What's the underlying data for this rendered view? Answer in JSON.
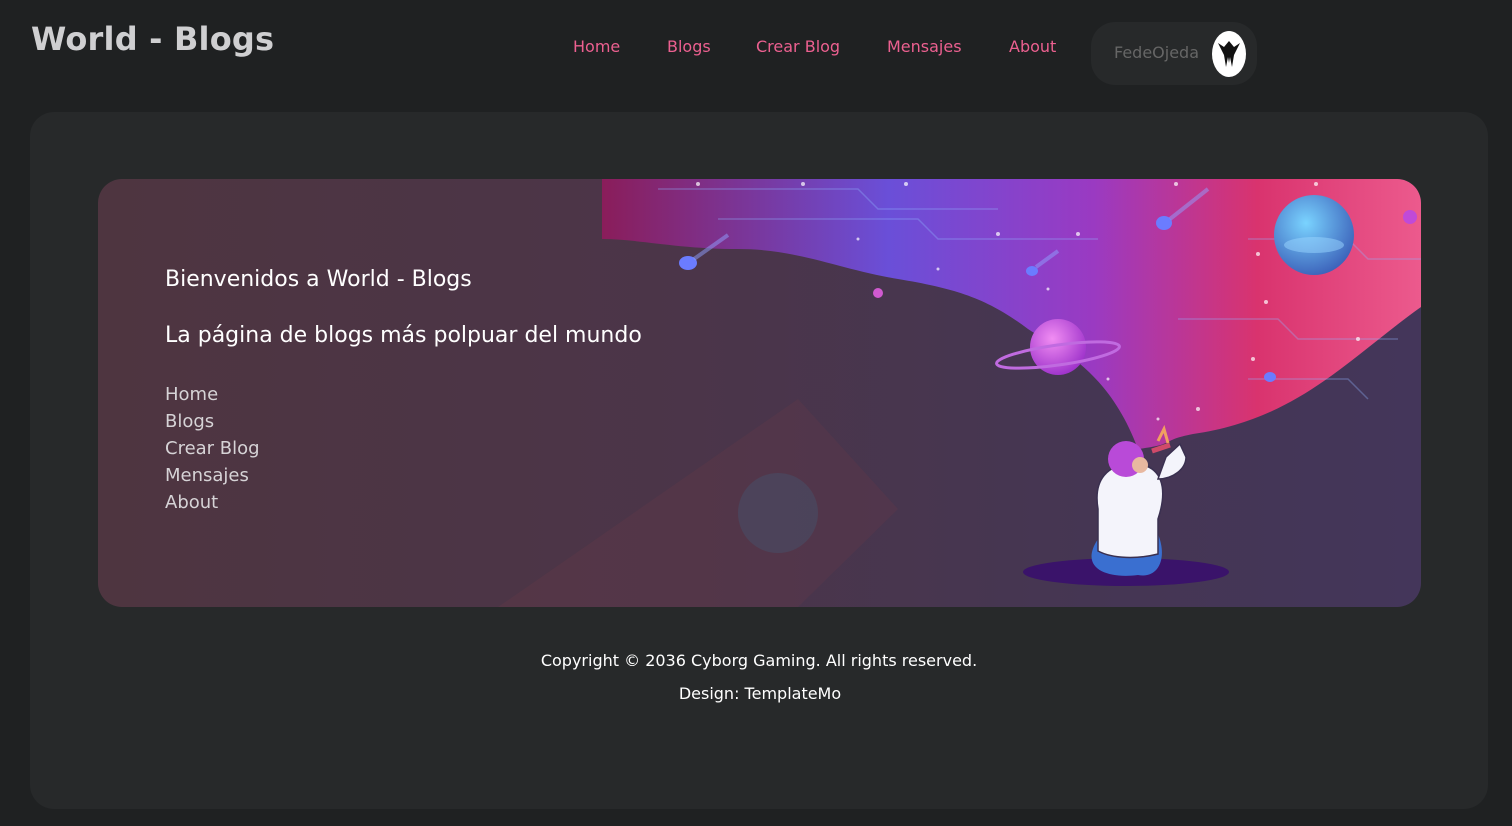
{
  "header": {
    "logo": "World - Blogs",
    "nav": [
      {
        "label": "Home"
      },
      {
        "label": "Blogs"
      },
      {
        "label": "Crear Blog"
      },
      {
        "label": "Mensajes"
      },
      {
        "label": "About"
      }
    ],
    "profile": {
      "username": "FedeOjeda",
      "avatar_icon": "user-avatar-icon"
    }
  },
  "banner": {
    "title": "Bienvenidos a World - Blogs",
    "subtitle": "La página de blogs más polpuar del mundo",
    "links": [
      "Home",
      "Blogs",
      "Crear Blog",
      "Mensajes",
      "About"
    ],
    "illustration": "space-astronaut-illustration"
  },
  "footer": {
    "copyright": "Copyright © 2036 Cyborg Gaming. All rights reserved.",
    "design": "Design: TemplateMo"
  },
  "colors": {
    "background": "#1f2122",
    "card": "#27292a",
    "accent": "#ec6090",
    "text": "#ffffff"
  }
}
